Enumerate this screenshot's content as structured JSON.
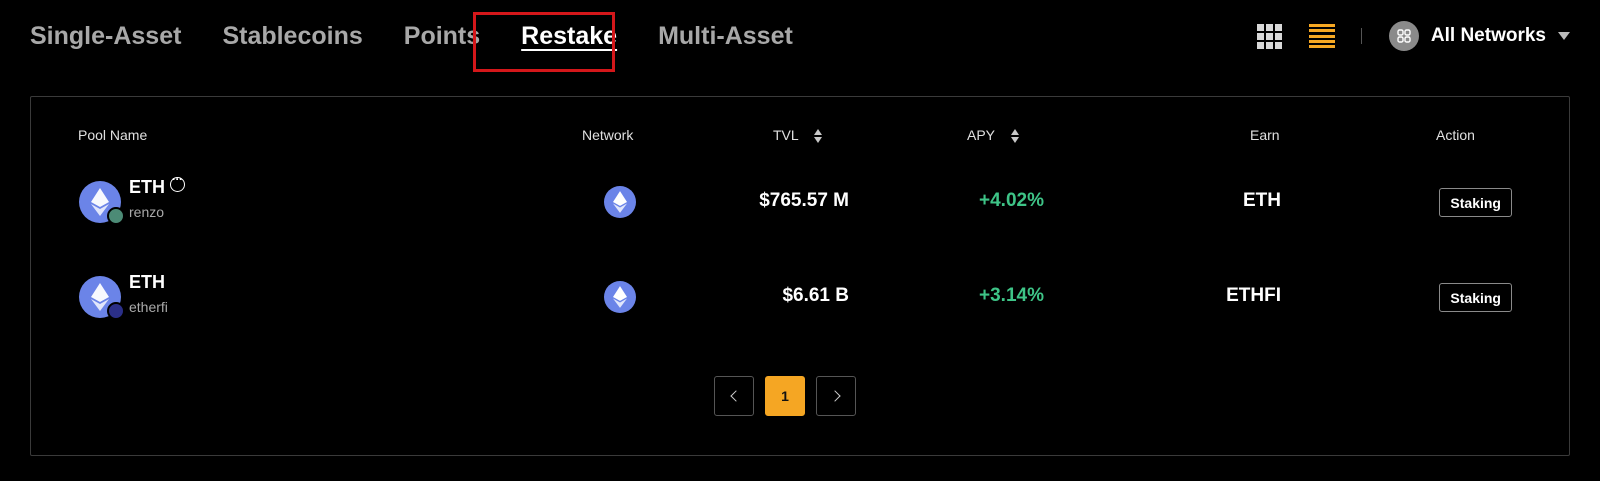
{
  "tabs": [
    {
      "label": "Single-Asset",
      "active": false
    },
    {
      "label": "Stablecoins",
      "active": false
    },
    {
      "label": "Points",
      "active": false
    },
    {
      "label": "Restake",
      "active": true
    },
    {
      "label": "Multi-Asset",
      "active": false
    }
  ],
  "view_toggle": {
    "grid_icon": "grid-icon",
    "list_icon": "list-icon",
    "active": "list"
  },
  "network_filter": {
    "label": "All Networks",
    "icon": "network-icon"
  },
  "table": {
    "headers": {
      "pool_name": "Pool Name",
      "network": "Network",
      "tvl": "TVL",
      "apy": "APY",
      "earn": "Earn",
      "action": "Action"
    },
    "rows": [
      {
        "token": "ETH",
        "provider": "renzo",
        "tvl": "$765.57 M",
        "apy": "+4.02%",
        "earn": "ETH",
        "action": "Staking"
      },
      {
        "token": "ETH",
        "provider": "etherfi",
        "tvl": "$6.61 B",
        "apy": "+3.14%",
        "earn": "ETHFI",
        "action": "Staking"
      }
    ]
  },
  "pagination": {
    "current_page": "1"
  },
  "colors": {
    "accent": "#f5a623",
    "positive": "#3ec487",
    "highlight_box": "#d4171a",
    "eth": "#6b84e8"
  }
}
